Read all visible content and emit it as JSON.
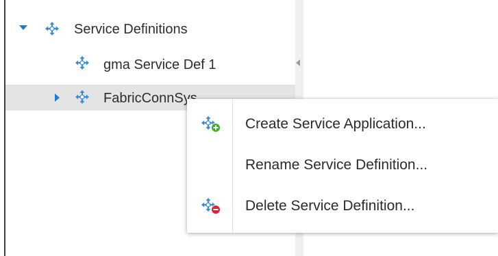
{
  "tree": {
    "nodes": [
      {
        "label": "Service Definitions",
        "icon": "service-definition-icon",
        "expander": "expanded"
      },
      {
        "label": "gma Service Def 1",
        "icon": "service-definition-icon",
        "expander": "none"
      },
      {
        "label": "FabricConnSys",
        "icon": "service-definition-icon",
        "expander": "collapsed",
        "selected": true
      }
    ]
  },
  "context_menu": {
    "items": [
      {
        "label": "Create Service Application...",
        "icon": "create-service-application-icon"
      },
      {
        "label": "Rename Service Definition...",
        "icon": ""
      },
      {
        "label": "Delete Service Definition...",
        "icon": "delete-service-definition-icon"
      }
    ]
  },
  "colors": {
    "accent": "#1e78d6",
    "icon_blue": "#3b8ad9",
    "add_badge": "#3fae29",
    "delete_badge": "#d9263b",
    "selected_row": "#e4e4e4"
  }
}
